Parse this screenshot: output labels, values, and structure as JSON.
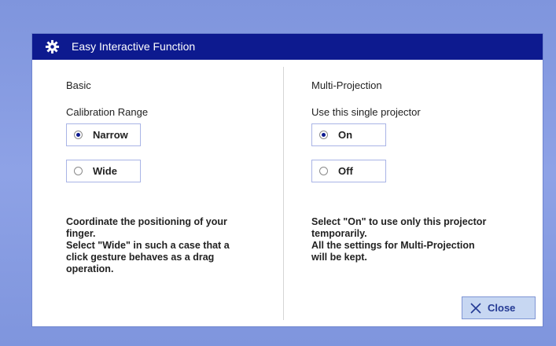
{
  "dialog": {
    "title": "Easy Interactive Function",
    "icon": "gear-icon"
  },
  "basic": {
    "section_title": "Basic",
    "setting_label": "Calibration Range",
    "options": [
      {
        "label": "Narrow",
        "selected": true
      },
      {
        "label": "Wide",
        "selected": false
      }
    ],
    "description": "Coordinate the positioning of your\nfinger.\nSelect \"Wide\" in such a case that a\nclick gesture behaves as a drag\noperation."
  },
  "multi_projection": {
    "section_title": "Multi-Projection",
    "setting_label": "Use this single projector",
    "options": [
      {
        "label": "On",
        "selected": true
      },
      {
        "label": "Off",
        "selected": false
      }
    ],
    "description": "Select \"On\" to use only this projector\ntemporarily.\nAll the settings for Multi-Projection\nwill be kept."
  },
  "close_button": {
    "label": "Close",
    "icon": "close-icon"
  },
  "colors": {
    "titlebar": "#0d1a8f",
    "background": "#8ea2e6",
    "button": "#c7d7f2"
  }
}
